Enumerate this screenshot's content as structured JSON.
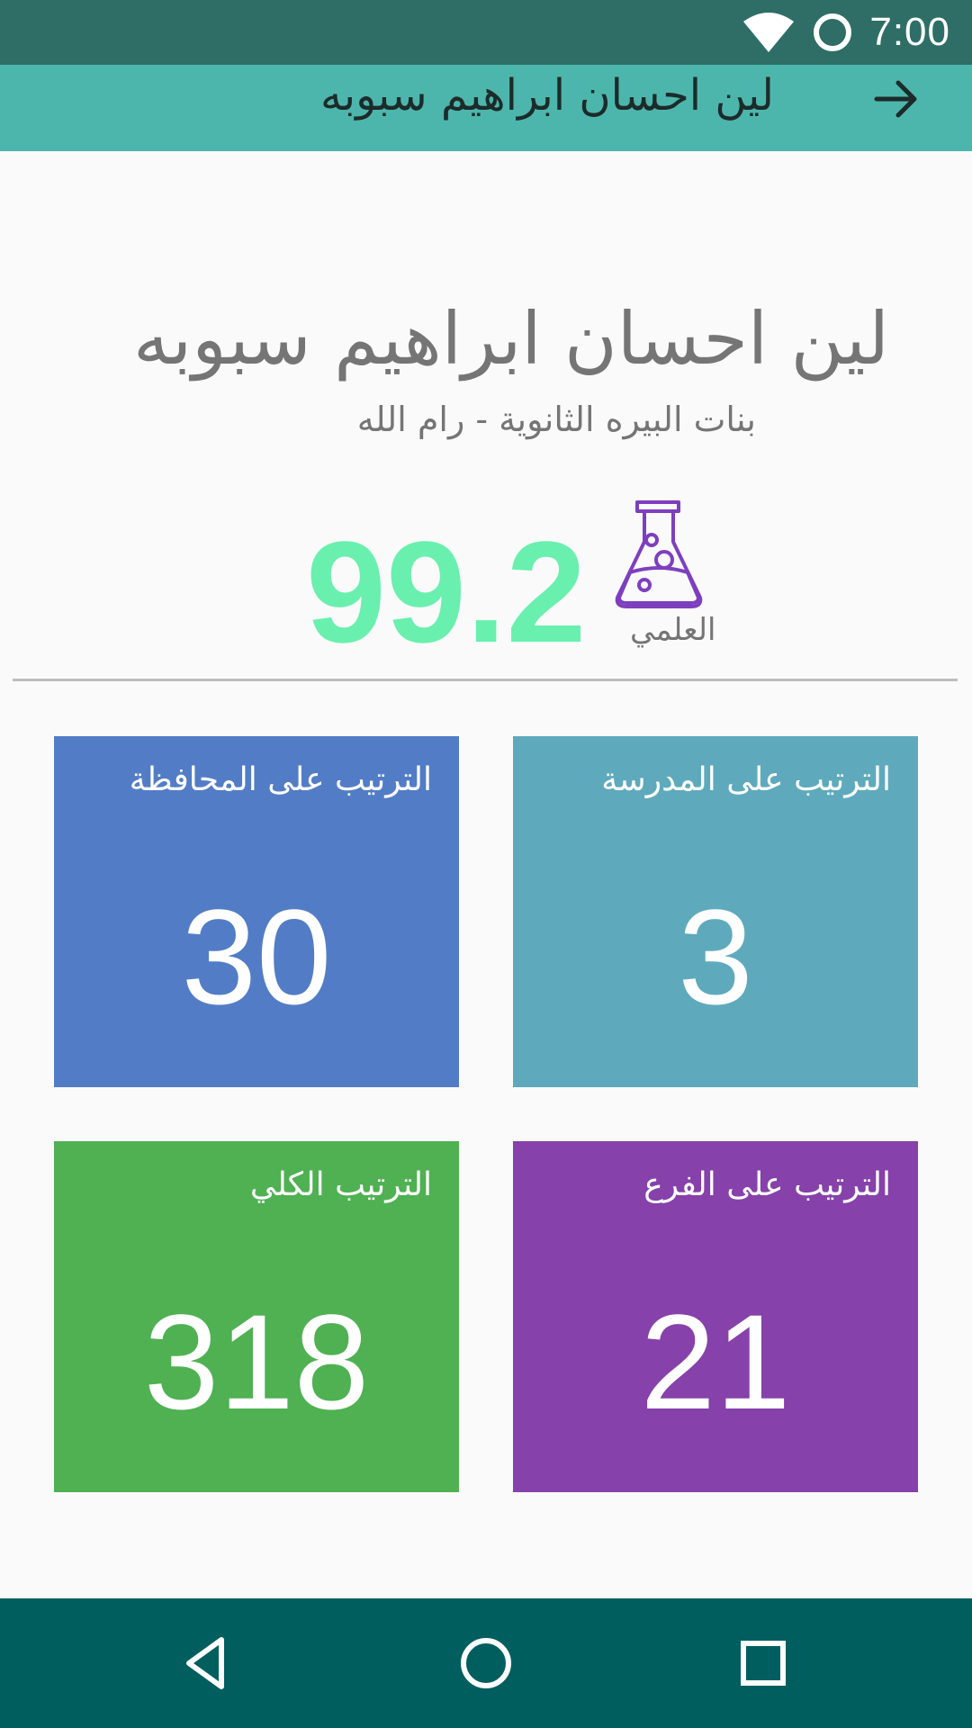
{
  "status_bar": {
    "time": "7:00",
    "icons": [
      "wifi-icon",
      "notification-circle-icon"
    ]
  },
  "app_bar": {
    "title": "لين احسان ابراهيم سبوبه",
    "back_icon": "arrow-forward-icon"
  },
  "header": {
    "student_name": "لين احسان ابراهيم سبوبه",
    "school_line": "بنات البيره الثانوية  -  رام الله",
    "score": "99.2",
    "branch": "العلمي",
    "branch_icon": "flask-icon"
  },
  "tiles": [
    {
      "label": "الترتيب على المدرسة",
      "value": "3",
      "color": "#5eaabc"
    },
    {
      "label": "الترتيب على المحافظة",
      "value": "30",
      "color": "#527dc6"
    },
    {
      "label": "الترتيب على الفرع",
      "value": "21",
      "color": "#8641aa"
    },
    {
      "label": "الترتيب الكلي",
      "value": "318",
      "color": "#4fb152"
    }
  ],
  "colors": {
    "status_bar": "#2e6e66",
    "app_bar": "#4db6ac",
    "score": "#69f0ae",
    "flask": "#7e3fbf",
    "nav_bar": "#005e5f"
  },
  "nav_bar": {
    "icons": [
      "back-triangle-icon",
      "home-circle-icon",
      "recents-square-icon"
    ]
  }
}
